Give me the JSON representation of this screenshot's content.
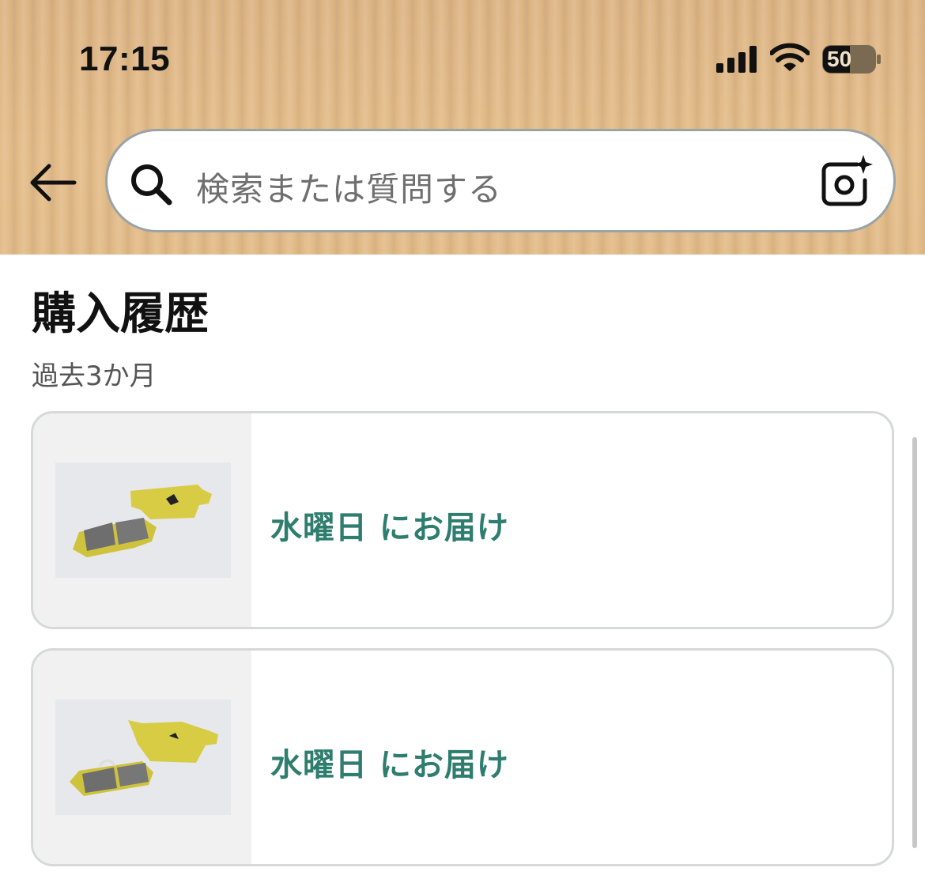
{
  "status_bar": {
    "time": "17:15",
    "battery": "50",
    "signal_icon": "cellular-signal-icon",
    "wifi_icon": "wifi-icon",
    "battery_icon": "battery-icon"
  },
  "nav": {
    "back_icon": "back-arrow-icon"
  },
  "search": {
    "placeholder": "検索または質問する",
    "search_icon": "search-icon",
    "camera_icon": "camera-lens-icon"
  },
  "section": {
    "title": "購入履歴",
    "subtitle": "過去3か月"
  },
  "orders": [
    {
      "delivery": "水曜日 にお届け",
      "image": "brake-pads-product-image"
    },
    {
      "delivery": "水曜日 にお届け",
      "image": "brake-pads-product-image"
    }
  ],
  "colors": {
    "header_bg": "#e2bb89",
    "delivery_text": "#2e7d6e",
    "card_border": "#d5d9d9"
  }
}
